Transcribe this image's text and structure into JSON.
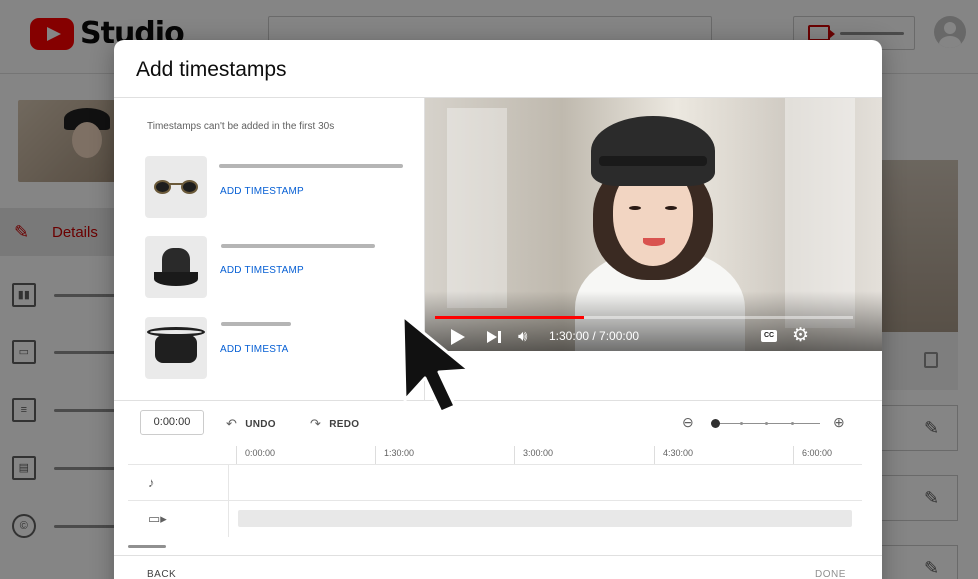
{
  "app": {
    "logo_text": "Studio",
    "nav_details_label": "Details"
  },
  "dialog": {
    "title": "Add timestamps",
    "hint": "Timestamps can't be added in the first 30s",
    "products": [
      {
        "name": "sunglasses",
        "link": "ADD TIMESTAMP"
      },
      {
        "name": "bucket-hat",
        "link": "ADD TIMESTAMP"
      },
      {
        "name": "belt-bag",
        "link": "ADD TIMESTA"
      }
    ],
    "player": {
      "time": "1:30:00 / 7:00:00",
      "progress_fraction": 0.357,
      "cc_label": "CC"
    },
    "toolbar": {
      "timecode": "0:00:00",
      "undo": "UNDO",
      "redo": "REDO"
    },
    "ruler_ticks": [
      "0:00:00",
      "1:30:00",
      "3:00:00",
      "4:30:00",
      "6:00:00"
    ],
    "footer": {
      "back": "BACK",
      "done": "DONE"
    }
  },
  "colors": {
    "brand_red": "#ff0000",
    "link_blue": "#065fd4",
    "details_red": "#cc0000"
  },
  "icons": [
    "youtube-logo-icon",
    "create-video-icon",
    "account-avatar-icon",
    "pencil-icon",
    "analytics-icon",
    "editor-icon",
    "comments-icon",
    "subtitles-icon",
    "copyright-icon",
    "play-icon",
    "next-icon",
    "volume-icon",
    "cc-icon",
    "settings-gear-icon",
    "undo-icon",
    "redo-icon",
    "zoom-out-icon",
    "zoom-in-icon",
    "music-note-icon",
    "video-track-icon",
    "mouse-cursor-icon"
  ]
}
